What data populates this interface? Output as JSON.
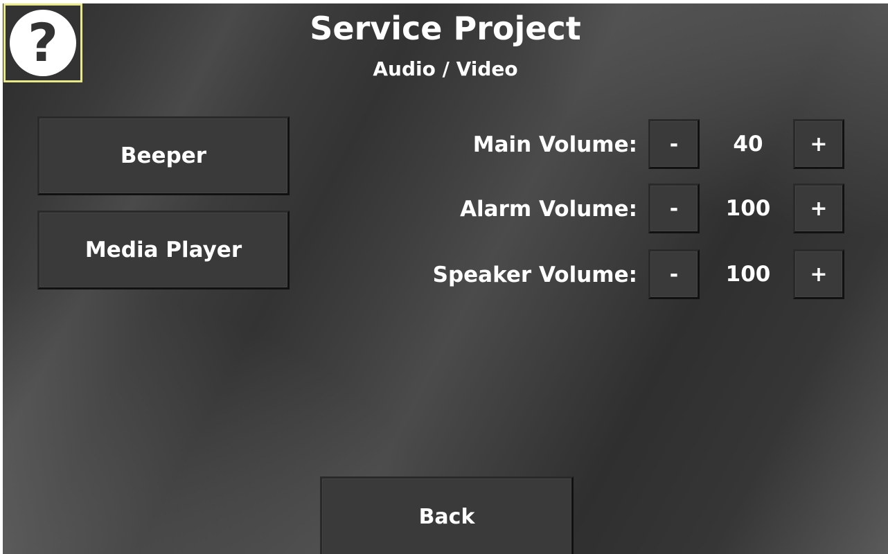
{
  "header": {
    "title": "Service Project",
    "subtitle": "Audio / Video",
    "help_glyph": "?"
  },
  "left_menu": {
    "beeper_label": "Beeper",
    "media_player_label": "Media Player"
  },
  "volumes": {
    "main": {
      "label": "Main Volume:",
      "value": "40",
      "minus": "-",
      "plus": "+"
    },
    "alarm": {
      "label": "Alarm Volume:",
      "value": "100",
      "minus": "-",
      "plus": "+"
    },
    "speaker": {
      "label": "Speaker Volume:",
      "value": "100",
      "minus": "-",
      "plus": "+"
    }
  },
  "footer": {
    "back_label": "Back"
  },
  "colors": {
    "background": "#3a3a3a",
    "help_border": "#e9e98a",
    "text": "#ffffff"
  },
  "icons": {
    "help": "help-icon"
  }
}
